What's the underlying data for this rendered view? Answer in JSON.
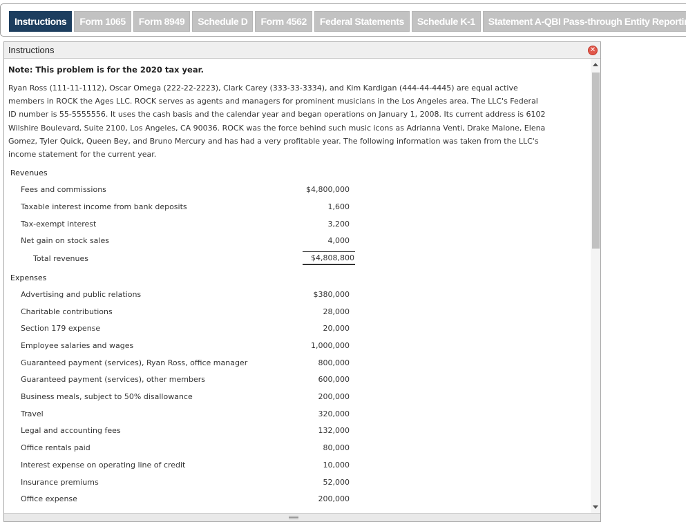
{
  "tabs": [
    {
      "label": "Instructions",
      "active": true
    },
    {
      "label": "Form 1065",
      "active": false
    },
    {
      "label": "Form 8949",
      "active": false
    },
    {
      "label": "Schedule D",
      "active": false
    },
    {
      "label": "Form 4562",
      "active": false
    },
    {
      "label": "Federal Statements",
      "active": false
    },
    {
      "label": "Schedule K-1",
      "active": false
    },
    {
      "label": "Statement A-QBI Pass-through Entity Reporting",
      "active": false
    }
  ],
  "dialog": {
    "title": "Instructions",
    "close_icon": "close-icon",
    "note": "Note: This problem is for the 2020 tax year.",
    "paragraph": "Ryan Ross (111-11-1112), Oscar Omega (222-22-2223), Clark Carey (333-33-3334), and Kim Kardigan (444-44-4445) are equal active members in ROCK the Ages LLC. ROCK serves as agents and managers for prominent musicians in the Los Angeles area. The LLC's Federal ID number is 55-5555556. It uses the cash basis and the calendar year and began operations on January 1, 2008. Its current address is 6102 Wilshire Boulevard, Suite 2100, Los Angeles, CA 90036. ROCK was the force behind such music icons as Adrianna Venti, Drake Malone, Elena Gomez, Tyler Quick, Queen Bey, and Bruno Mercury and has had a very profitable year. The following information was taken from the LLC's income statement for the current year."
  },
  "revenues": {
    "label": "Revenues",
    "items": [
      {
        "label": "Fees and commissions",
        "amount": "$4,800,000"
      },
      {
        "label": "Taxable interest income from bank deposits",
        "amount": "1,600"
      },
      {
        "label": "Tax-exempt interest",
        "amount": "3,200"
      },
      {
        "label": "Net gain on stock sales",
        "amount": "4,000"
      }
    ],
    "total_label": "Total revenues",
    "total_amount": "$4,808,800"
  },
  "expenses": {
    "label": "Expenses",
    "items": [
      {
        "label": "Advertising and public relations",
        "amount": "$380,000"
      },
      {
        "label": "Charitable contributions",
        "amount": "28,000"
      },
      {
        "label": "Section 179 expense",
        "amount": "20,000"
      },
      {
        "label": "Employee salaries and wages",
        "amount": "1,000,000"
      },
      {
        "label": "Guaranteed payment (services), Ryan Ross, office manager",
        "amount": "800,000"
      },
      {
        "label": "Guaranteed payment (services), other members",
        "amount": "600,000"
      },
      {
        "label": "Business meals, subject to 50% disallowance",
        "amount": "200,000"
      },
      {
        "label": "Travel",
        "amount": "320,000"
      },
      {
        "label": "Legal and accounting fees",
        "amount": "132,000"
      },
      {
        "label": "Office rentals paid",
        "amount": "80,000"
      },
      {
        "label": "Interest expense on operating line of credit",
        "amount": "10,000"
      },
      {
        "label": "Insurance premiums",
        "amount": "52,000"
      },
      {
        "label": "Office expense",
        "amount": "200,000"
      }
    ]
  }
}
